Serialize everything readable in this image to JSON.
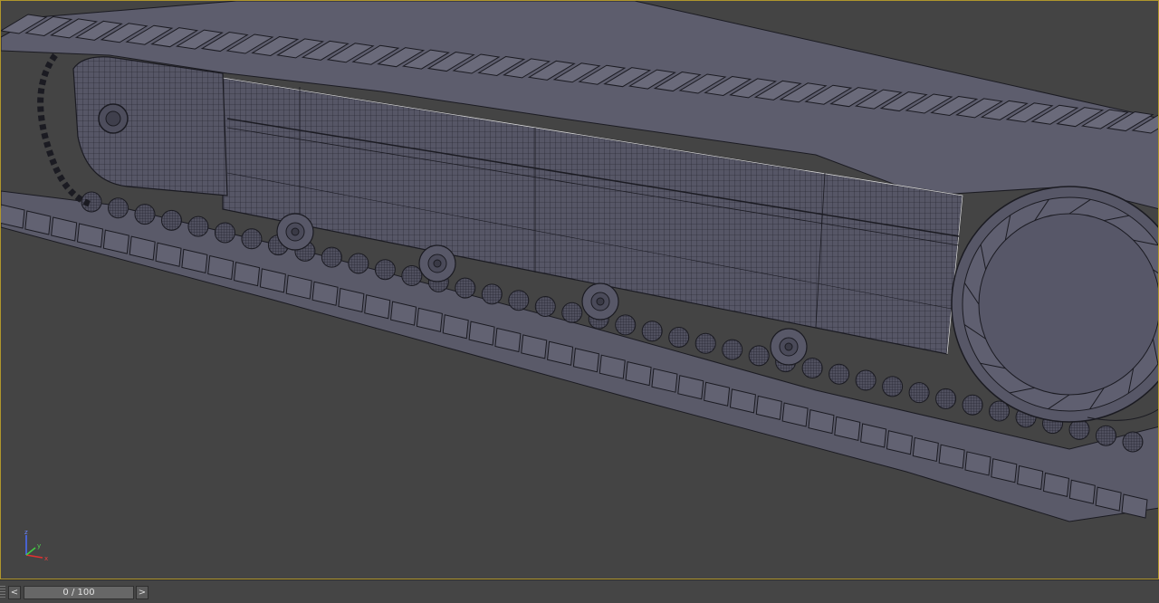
{
  "viewport": {
    "label": "",
    "background": "#444444",
    "border_color": "#b0962c",
    "mesh_color": "#5a5a6a",
    "wire_color": "#1b1b22"
  },
  "axis_gizmo": {
    "x_label": "x",
    "y_label": "y",
    "z_label": "z"
  },
  "timeline": {
    "prev_label": "<",
    "next_label": ">",
    "frame_text": "0 / 100",
    "current_frame": 0,
    "total_frames": 100
  }
}
